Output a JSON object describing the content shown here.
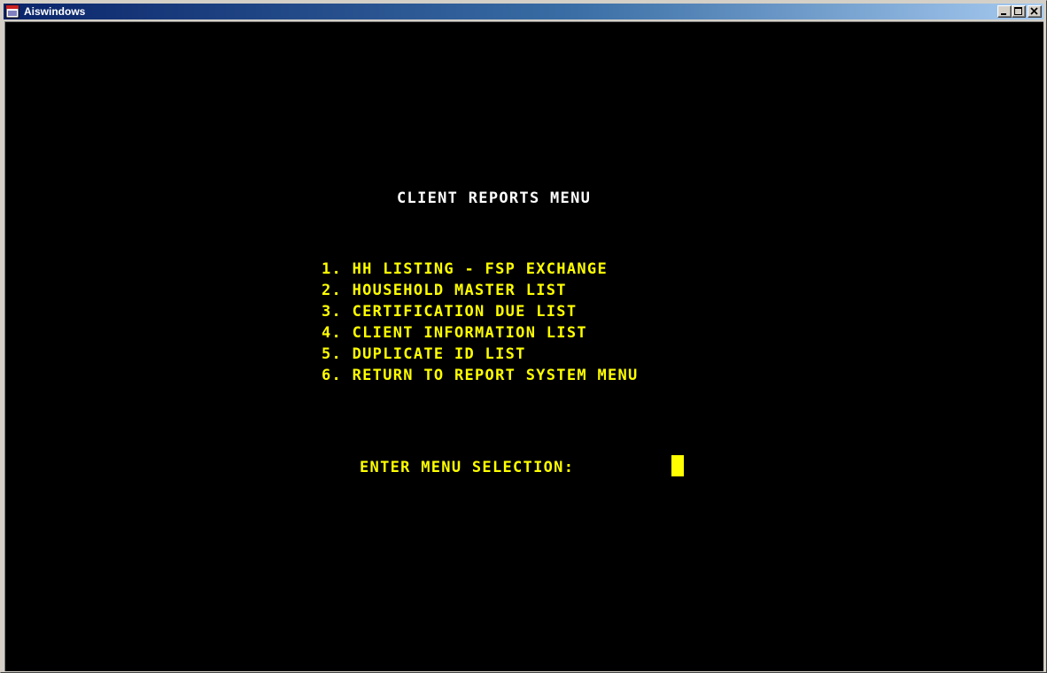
{
  "window": {
    "title": "Aiswindows",
    "icon": "app-window-icon",
    "controls": [
      "minimize-icon",
      "maximize-icon",
      "close-icon"
    ]
  },
  "screen": {
    "menu_title": "CLIENT REPORTS MENU",
    "menu_items": [
      "1. HH LISTING - FSP EXCHANGE",
      "2. HOUSEHOLD MASTER LIST",
      "3. CERTIFICATION DUE LIST",
      "4. CLIENT INFORMATION LIST",
      "5. DUPLICATE ID LIST",
      "6. RETURN TO REPORT SYSTEM MENU"
    ],
    "prompt": "ENTER MENU SELECTION:",
    "input_value": ""
  },
  "colors": {
    "background": "#000000",
    "text": "#ffff00",
    "title_text": "#ffffff",
    "titlebar_start": "#0a246a",
    "titlebar_end": "#a6caf0"
  }
}
